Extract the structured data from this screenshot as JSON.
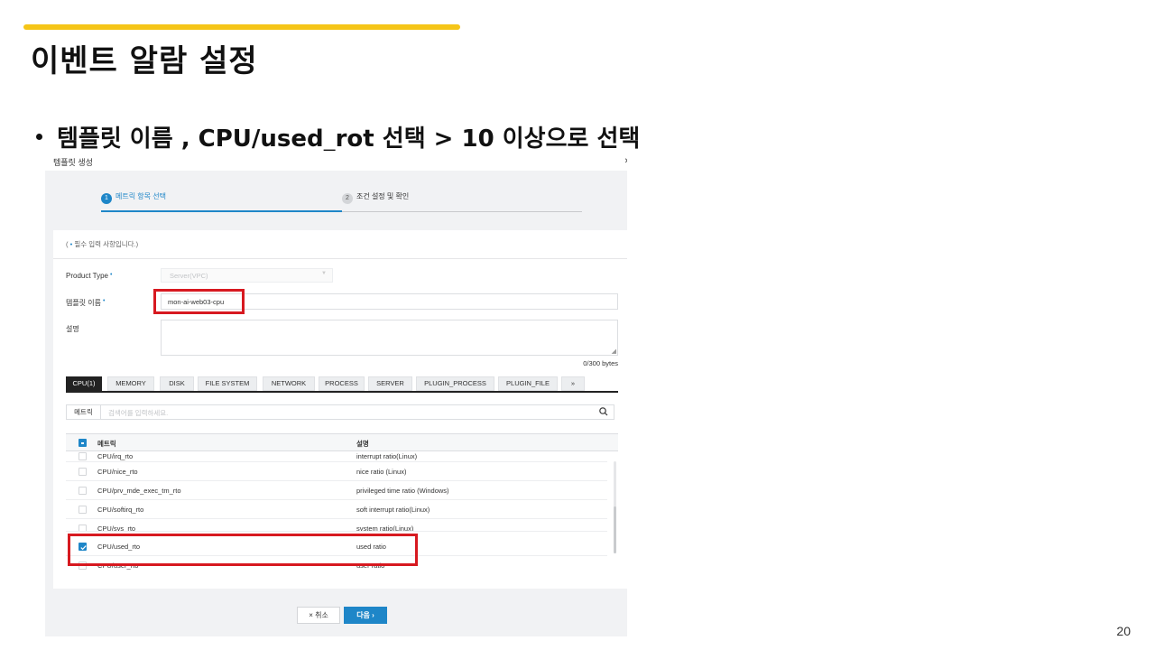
{
  "slide": {
    "title": "이벤트 알람 설정",
    "bullet": "템플릿 이름 , CPU/used_rot 선택 > 10 이상으로 선택",
    "page_number": "20"
  },
  "modal": {
    "title": "템플릿 생성",
    "close_icon": "chevron-right",
    "steps": [
      {
        "number": "1",
        "label": "메트릭 항목 선택"
      },
      {
        "number": "2",
        "label": "조건 설정 및 확인"
      }
    ],
    "required_note_prefix": "(",
    "required_note_dot": "•",
    "required_note_text": " 필수 입력 사항입니다.)",
    "form": {
      "product_type_label": "Product Type",
      "product_type_value": "Server(VPC)",
      "template_name_label": "템플릿 이름",
      "template_name_value": "mon-ai-web03-cpu",
      "description_label": "설명",
      "byte_count": "0/300 bytes",
      "required_mark": "•"
    },
    "tabs": [
      "CPU(1)",
      "MEMORY",
      "DISK",
      "FILE SYSTEM",
      "NETWORK",
      "PROCESS",
      "SERVER",
      "PLUGIN_PROCESS",
      "PLUGIN_FILE",
      "»"
    ],
    "active_tab": "CPU(1)",
    "search": {
      "tag": "메트릭",
      "placeholder": "검색어를 입력하세요."
    },
    "table": {
      "headers": [
        "메트릭",
        "설명"
      ],
      "rows": [
        {
          "metric": "CPU/irq_rto",
          "description": "interrupt ratio(Linux)",
          "checked": false
        },
        {
          "metric": "CPU/nice_rto",
          "description": "nice ratio (Linux)",
          "checked": false
        },
        {
          "metric": "CPU/prv_mde_exec_tm_rto",
          "description": "privileged time ratio (Windows)",
          "checked": false
        },
        {
          "metric": "CPU/softirq_rto",
          "description": "soft interrupt ratio(Linux)",
          "checked": false
        },
        {
          "metric": "CPU/sys_rto",
          "description": "system ratio(Linux)",
          "checked": false
        },
        {
          "metric": "CPU/used_rto",
          "description": "used ratio",
          "checked": true
        },
        {
          "metric": "CPU/user_rto",
          "description": "user ratio",
          "checked": false
        }
      ]
    },
    "buttons": {
      "cancel": "× 취소",
      "next": "다음 ›"
    },
    "colors": {
      "primary": "#1e86c8",
      "highlight": "#d71920",
      "accent": "#f5c518"
    }
  }
}
